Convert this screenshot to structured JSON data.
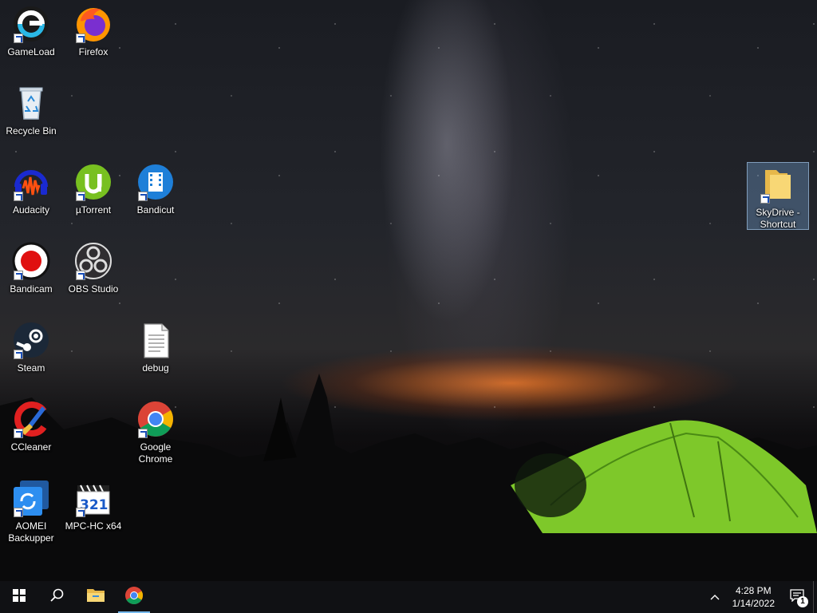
{
  "desktop": {
    "icons": [
      {
        "label": "GameLoad"
      },
      {
        "label": "Firefox"
      },
      {
        "label": "Recycle Bin"
      },
      {
        "label": "Audacity"
      },
      {
        "label": "µTorrent"
      },
      {
        "label": "Bandicut"
      },
      {
        "label": "Bandicam"
      },
      {
        "label": "OBS Studio"
      },
      {
        "label": "Steam"
      },
      {
        "label": "debug"
      },
      {
        "label": "CCleaner"
      },
      {
        "label": "Google Chrome"
      },
      {
        "label": "AOMEI Backupper"
      },
      {
        "label": "MPC-HC x64"
      },
      {
        "label": "SkyDrive - Shortcut"
      }
    ]
  },
  "taskbar": {
    "start_icon": "windows-icon",
    "search_icon": "search-icon",
    "pinned": [
      "file-explorer-icon",
      "chrome-icon"
    ],
    "clock": {
      "time": "4:28 PM",
      "date": "1/14/2022"
    },
    "notification_count": "1",
    "accent": "#76b9ed"
  }
}
